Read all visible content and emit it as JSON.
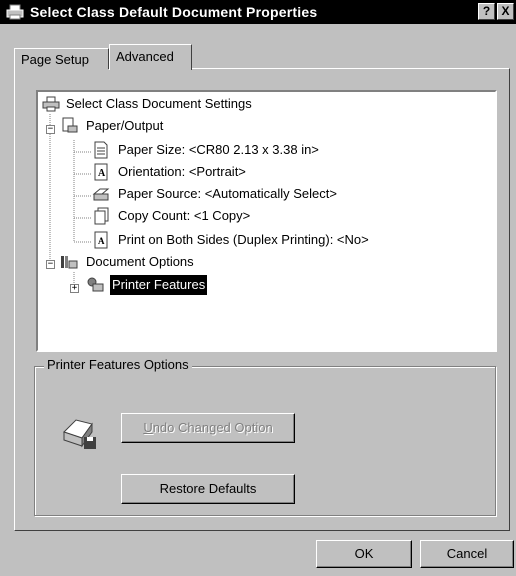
{
  "window": {
    "title": "Select Class Default Document Properties",
    "help_label": "?",
    "close_label": "X"
  },
  "tabs": [
    {
      "label": "Page Setup"
    },
    {
      "label": "Advanced"
    }
  ],
  "tree": {
    "root": {
      "label": "Select Class Document Settings"
    },
    "paper_output": {
      "label": "Paper/Output",
      "items": [
        {
          "label": "Paper Size: <CR80 2.13 x 3.38 in>"
        },
        {
          "label": "Orientation: <Portrait>"
        },
        {
          "label": "Paper Source: <Automatically Select>"
        },
        {
          "label": "Copy Count: <1 Copy>"
        },
        {
          "label": "Print on Both Sides (Duplex Printing): <No>"
        }
      ]
    },
    "document_options": {
      "label": "Document Options"
    },
    "printer_features": {
      "label": "Printer Features"
    }
  },
  "options_group": {
    "title": "Printer Features Options",
    "undo_underline": "U",
    "undo_rest": "ndo Changed Option",
    "restore_label": "Restore Defaults"
  },
  "footer": {
    "ok_label": "OK",
    "cancel_label": "Cancel"
  }
}
